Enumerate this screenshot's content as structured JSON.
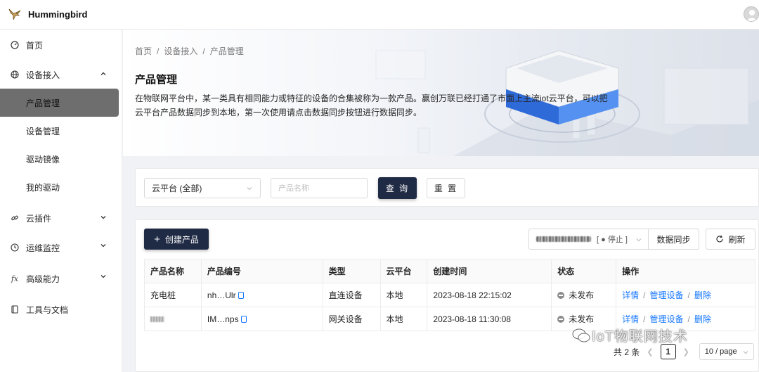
{
  "app": {
    "title": "Hummingbird"
  },
  "sidebar": {
    "items": [
      {
        "label": "首页",
        "icon": "dashboard-icon"
      },
      {
        "label": "设备接入",
        "icon": "globe-icon",
        "expanded": true,
        "children": [
          {
            "label": "产品管理",
            "active": true
          },
          {
            "label": "设备管理"
          },
          {
            "label": "驱动镜像"
          },
          {
            "label": "我的驱动"
          }
        ]
      },
      {
        "label": "云插件",
        "icon": "link-icon"
      },
      {
        "label": "运维监控",
        "icon": "clock-icon"
      },
      {
        "label": "高级能力",
        "icon": "fx-icon"
      },
      {
        "label": "工具与文档",
        "icon": "document-icon"
      }
    ]
  },
  "breadcrumb": [
    "首页",
    "设备接入",
    "产品管理"
  ],
  "page": {
    "title": "产品管理",
    "description": "在物联网平台中，某一类具有相同能力或特征的设备的合集被称为一款产品。赢创万联已经打通了市面上主流iot云平台，可以把云平台产品数据同步到本地，第一次使用请点击数据同步按钮进行数据同步。"
  },
  "filters": {
    "cloud_select": "云平台 (全部)",
    "name_placeholder": "产品名称",
    "query_label": "查 询",
    "reset_label": "重 置"
  },
  "toolbar": {
    "create_label": "创建产品",
    "cloud_status": "[ ● 停止 ]",
    "sync_label": "数据同步",
    "refresh_label": "刷新"
  },
  "table": {
    "columns": [
      "产品名称",
      "产品编号",
      "类型",
      "云平台",
      "创建时间",
      "状态",
      "操作"
    ],
    "rows": [
      {
        "name": "充电桩",
        "code": "nh…Ulr",
        "type": "直连设备",
        "cloud": "本地",
        "created": "2023-08-18 22:15:02",
        "status": "未发布"
      },
      {
        "name": "",
        "code": "IM…nps",
        "type": "网关设备",
        "cloud": "本地",
        "created": "2023-08-18 11:30:08",
        "status": "未发布"
      }
    ],
    "actions": {
      "detail": "详情",
      "manage": "管理设备",
      "delete": "删除",
      "separator": "/"
    }
  },
  "pagination": {
    "total": "共 2 条",
    "current": "1",
    "page_size": "10 / page"
  },
  "watermark": "IoT物联网技术",
  "colors": {
    "primary_button": "#1f2a44",
    "link": "#1677ff",
    "active_nav": "#6e6e6e"
  }
}
